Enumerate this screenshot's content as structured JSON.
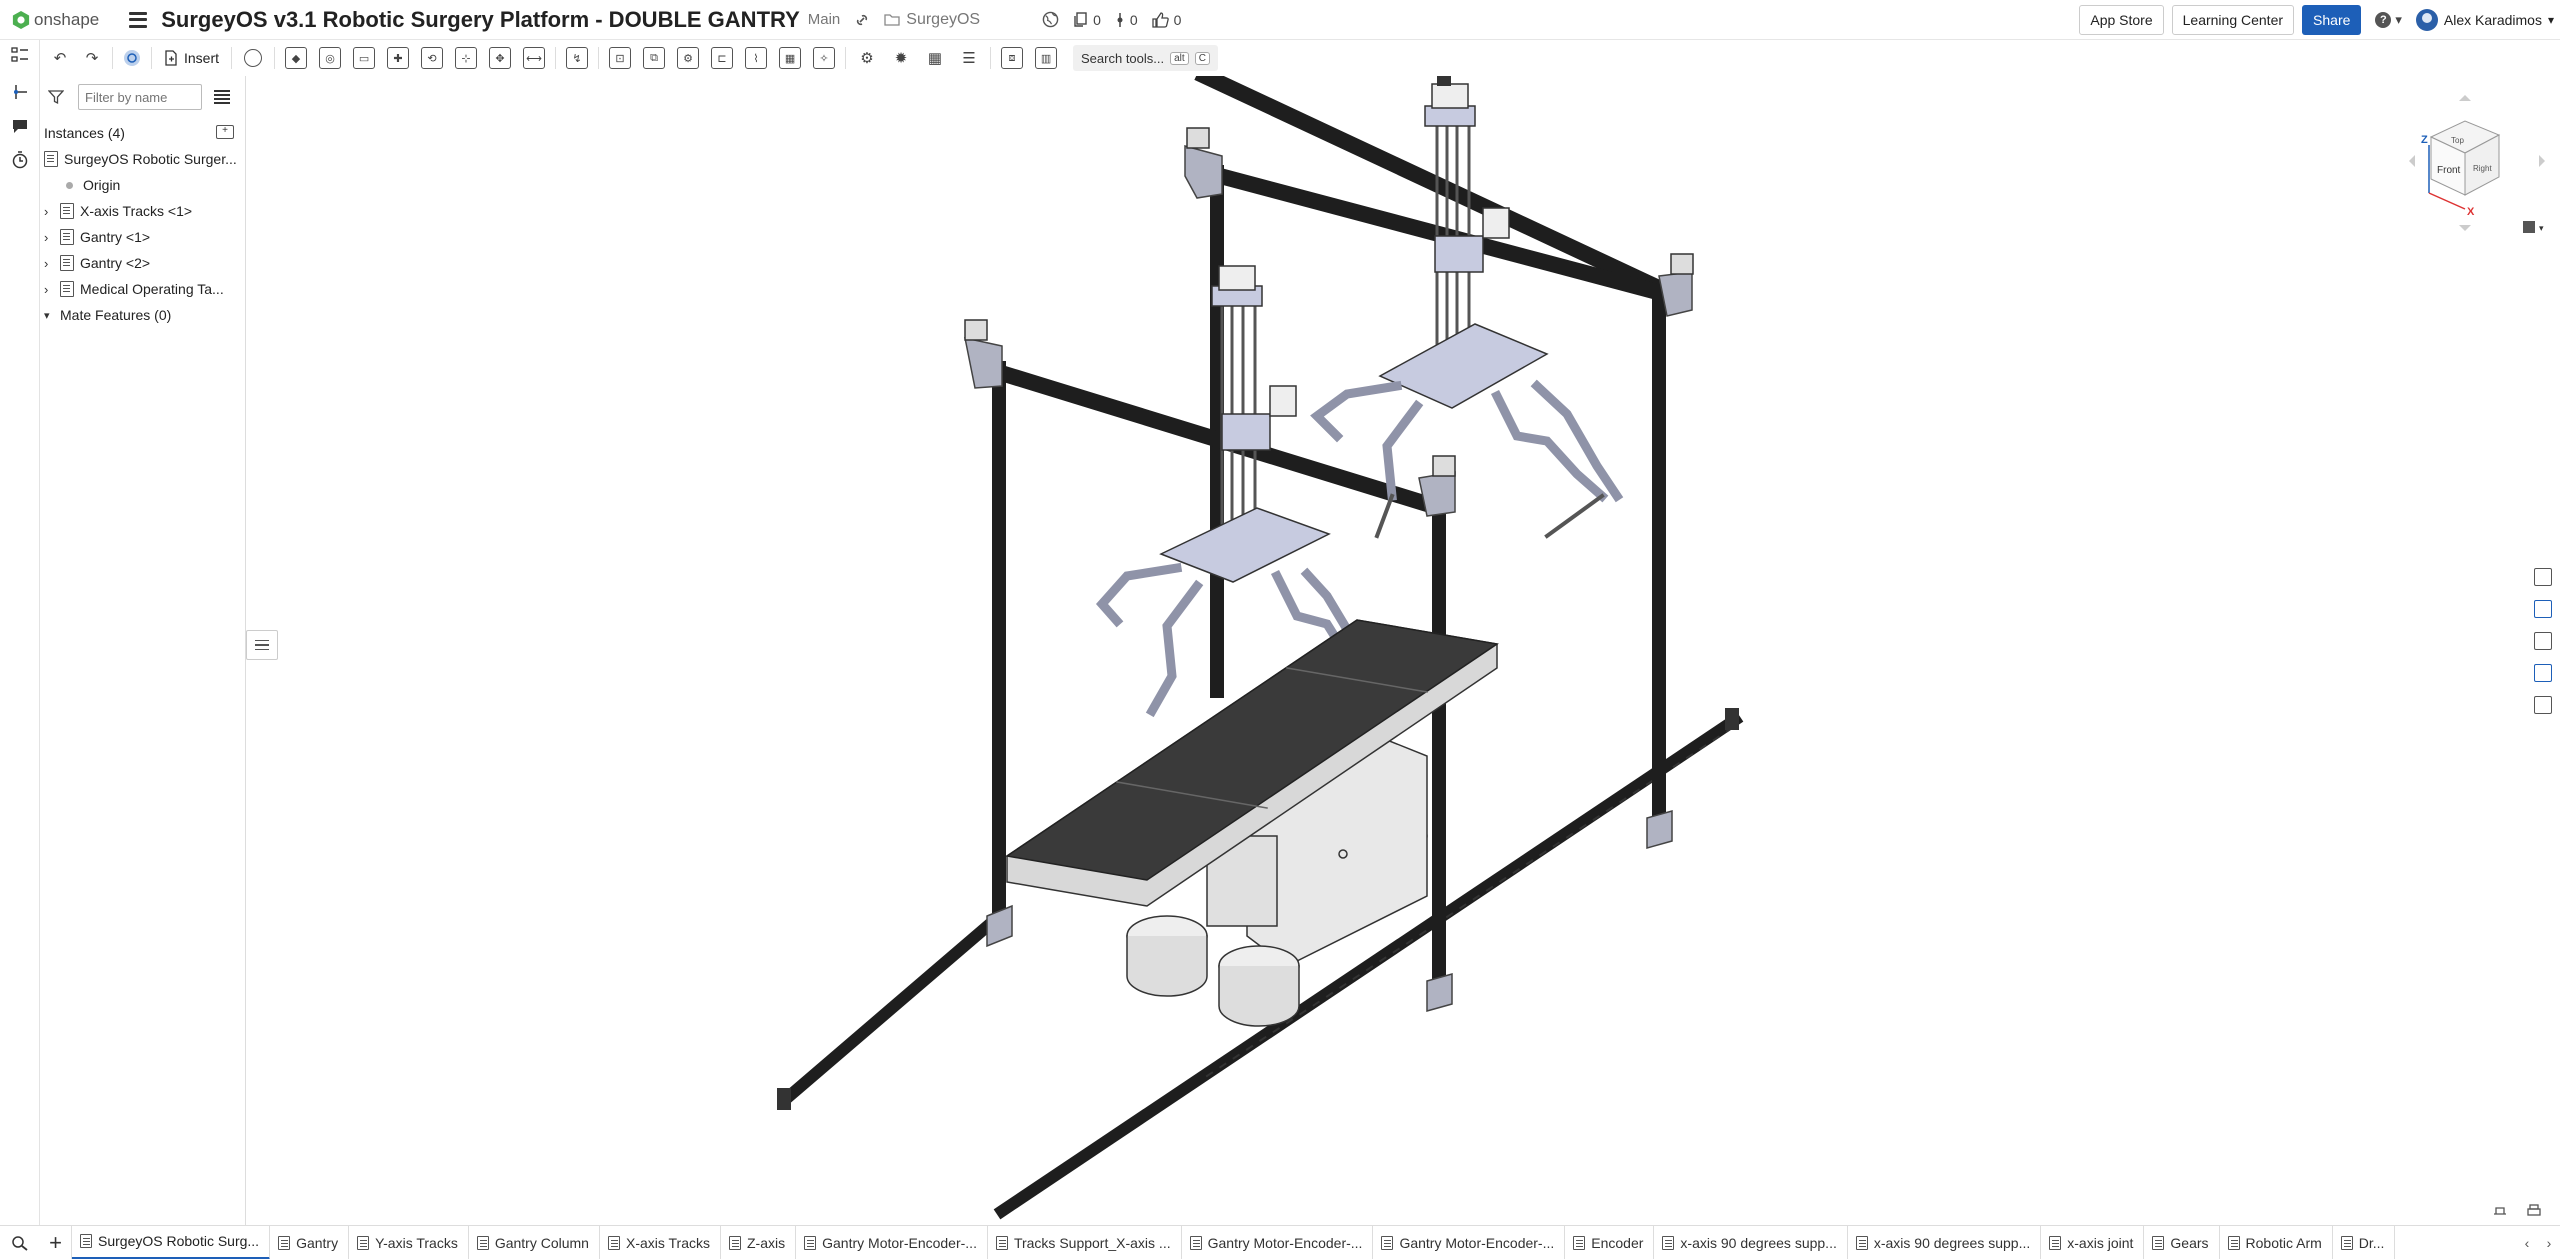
{
  "header": {
    "logo_text": "onshape",
    "document_title": "SurgeyOS v3.1 Robotic Surgery Platform - DOUBLE GANTRY",
    "branch": "Main",
    "folder": "SurgeyOS",
    "counters": {
      "versions": "0",
      "branches": "0",
      "likes": "0"
    },
    "app_store_label": "App Store",
    "learning_center_label": "Learning Center",
    "share_label": "Share",
    "user_name": "Alex Karadimos"
  },
  "toolbar": {
    "insert_label": "Insert",
    "search_label": "Search tools...",
    "search_shortcut_alt": "alt",
    "search_shortcut_key": "C"
  },
  "panel": {
    "filter_placeholder": "Filter by name",
    "instances_label": "Instances (4)",
    "items": [
      {
        "label": "SurgeyOS Robotic Surger..."
      },
      {
        "label": "Origin"
      },
      {
        "label": "X-axis Tracks <1>"
      },
      {
        "label": "Gantry <1>"
      },
      {
        "label": "Gantry <2>"
      },
      {
        "label": "Medical Operating Ta..."
      }
    ],
    "mate_features_label": "Mate Features (0)"
  },
  "viewcube": {
    "front_label": "Front",
    "top_label": "Top",
    "right_label": "Right",
    "axis_z": "Z",
    "axis_x": "X"
  },
  "tabs": [
    {
      "label": "SurgeyOS Robotic Surg..."
    },
    {
      "label": "Gantry"
    },
    {
      "label": "Y-axis Tracks"
    },
    {
      "label": "Gantry Column"
    },
    {
      "label": "X-axis Tracks"
    },
    {
      "label": "Z-axis"
    },
    {
      "label": "Gantry Motor-Encoder-..."
    },
    {
      "label": "Tracks Support_X-axis ..."
    },
    {
      "label": "Gantry Motor-Encoder-..."
    },
    {
      "label": "Gantry Motor-Encoder-..."
    },
    {
      "label": "Encoder"
    },
    {
      "label": "x-axis 90 degrees supp..."
    },
    {
      "label": "x-axis 90 degrees supp..."
    },
    {
      "label": "x-axis joint"
    },
    {
      "label": "Gears"
    },
    {
      "label": "Robotic Arm"
    },
    {
      "label": "Dr..."
    }
  ],
  "colors": {
    "accent": "#1d5fb8",
    "frame": "#1e1e1e",
    "plate": "#c7cbe0",
    "table_top": "#3a3a3a",
    "base": "#e8e8e8"
  }
}
